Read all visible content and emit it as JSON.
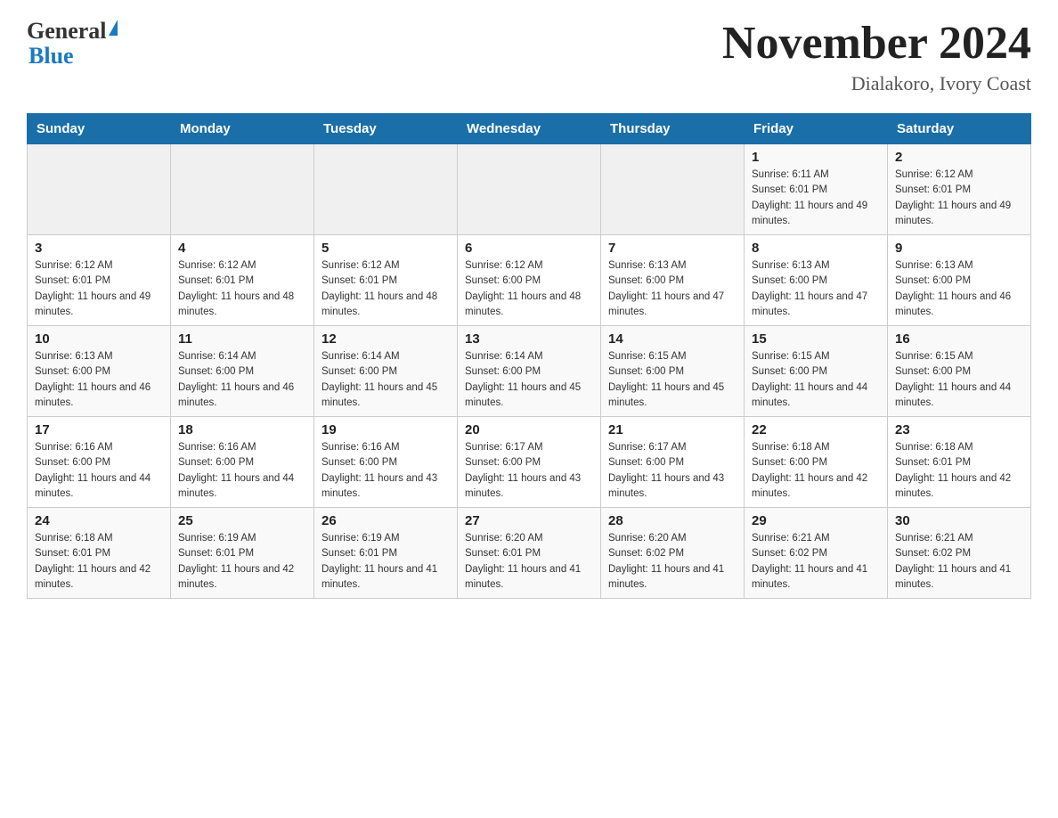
{
  "header": {
    "logo_general": "General",
    "logo_blue": "Blue",
    "title": "November 2024",
    "subtitle": "Dialakoro, Ivory Coast"
  },
  "days_of_week": [
    "Sunday",
    "Monday",
    "Tuesday",
    "Wednesday",
    "Thursday",
    "Friday",
    "Saturday"
  ],
  "weeks": [
    {
      "days": [
        {
          "number": "",
          "info": ""
        },
        {
          "number": "",
          "info": ""
        },
        {
          "number": "",
          "info": ""
        },
        {
          "number": "",
          "info": ""
        },
        {
          "number": "",
          "info": ""
        },
        {
          "number": "1",
          "info": "Sunrise: 6:11 AM\nSunset: 6:01 PM\nDaylight: 11 hours and 49 minutes."
        },
        {
          "number": "2",
          "info": "Sunrise: 6:12 AM\nSunset: 6:01 PM\nDaylight: 11 hours and 49 minutes."
        }
      ]
    },
    {
      "days": [
        {
          "number": "3",
          "info": "Sunrise: 6:12 AM\nSunset: 6:01 PM\nDaylight: 11 hours and 49 minutes."
        },
        {
          "number": "4",
          "info": "Sunrise: 6:12 AM\nSunset: 6:01 PM\nDaylight: 11 hours and 48 minutes."
        },
        {
          "number": "5",
          "info": "Sunrise: 6:12 AM\nSunset: 6:01 PM\nDaylight: 11 hours and 48 minutes."
        },
        {
          "number": "6",
          "info": "Sunrise: 6:12 AM\nSunset: 6:00 PM\nDaylight: 11 hours and 48 minutes."
        },
        {
          "number": "7",
          "info": "Sunrise: 6:13 AM\nSunset: 6:00 PM\nDaylight: 11 hours and 47 minutes."
        },
        {
          "number": "8",
          "info": "Sunrise: 6:13 AM\nSunset: 6:00 PM\nDaylight: 11 hours and 47 minutes."
        },
        {
          "number": "9",
          "info": "Sunrise: 6:13 AM\nSunset: 6:00 PM\nDaylight: 11 hours and 46 minutes."
        }
      ]
    },
    {
      "days": [
        {
          "number": "10",
          "info": "Sunrise: 6:13 AM\nSunset: 6:00 PM\nDaylight: 11 hours and 46 minutes."
        },
        {
          "number": "11",
          "info": "Sunrise: 6:14 AM\nSunset: 6:00 PM\nDaylight: 11 hours and 46 minutes."
        },
        {
          "number": "12",
          "info": "Sunrise: 6:14 AM\nSunset: 6:00 PM\nDaylight: 11 hours and 45 minutes."
        },
        {
          "number": "13",
          "info": "Sunrise: 6:14 AM\nSunset: 6:00 PM\nDaylight: 11 hours and 45 minutes."
        },
        {
          "number": "14",
          "info": "Sunrise: 6:15 AM\nSunset: 6:00 PM\nDaylight: 11 hours and 45 minutes."
        },
        {
          "number": "15",
          "info": "Sunrise: 6:15 AM\nSunset: 6:00 PM\nDaylight: 11 hours and 44 minutes."
        },
        {
          "number": "16",
          "info": "Sunrise: 6:15 AM\nSunset: 6:00 PM\nDaylight: 11 hours and 44 minutes."
        }
      ]
    },
    {
      "days": [
        {
          "number": "17",
          "info": "Sunrise: 6:16 AM\nSunset: 6:00 PM\nDaylight: 11 hours and 44 minutes."
        },
        {
          "number": "18",
          "info": "Sunrise: 6:16 AM\nSunset: 6:00 PM\nDaylight: 11 hours and 44 minutes."
        },
        {
          "number": "19",
          "info": "Sunrise: 6:16 AM\nSunset: 6:00 PM\nDaylight: 11 hours and 43 minutes."
        },
        {
          "number": "20",
          "info": "Sunrise: 6:17 AM\nSunset: 6:00 PM\nDaylight: 11 hours and 43 minutes."
        },
        {
          "number": "21",
          "info": "Sunrise: 6:17 AM\nSunset: 6:00 PM\nDaylight: 11 hours and 43 minutes."
        },
        {
          "number": "22",
          "info": "Sunrise: 6:18 AM\nSunset: 6:00 PM\nDaylight: 11 hours and 42 minutes."
        },
        {
          "number": "23",
          "info": "Sunrise: 6:18 AM\nSunset: 6:01 PM\nDaylight: 11 hours and 42 minutes."
        }
      ]
    },
    {
      "days": [
        {
          "number": "24",
          "info": "Sunrise: 6:18 AM\nSunset: 6:01 PM\nDaylight: 11 hours and 42 minutes."
        },
        {
          "number": "25",
          "info": "Sunrise: 6:19 AM\nSunset: 6:01 PM\nDaylight: 11 hours and 42 minutes."
        },
        {
          "number": "26",
          "info": "Sunrise: 6:19 AM\nSunset: 6:01 PM\nDaylight: 11 hours and 41 minutes."
        },
        {
          "number": "27",
          "info": "Sunrise: 6:20 AM\nSunset: 6:01 PM\nDaylight: 11 hours and 41 minutes."
        },
        {
          "number": "28",
          "info": "Sunrise: 6:20 AM\nSunset: 6:02 PM\nDaylight: 11 hours and 41 minutes."
        },
        {
          "number": "29",
          "info": "Sunrise: 6:21 AM\nSunset: 6:02 PM\nDaylight: 11 hours and 41 minutes."
        },
        {
          "number": "30",
          "info": "Sunrise: 6:21 AM\nSunset: 6:02 PM\nDaylight: 11 hours and 41 minutes."
        }
      ]
    }
  ]
}
